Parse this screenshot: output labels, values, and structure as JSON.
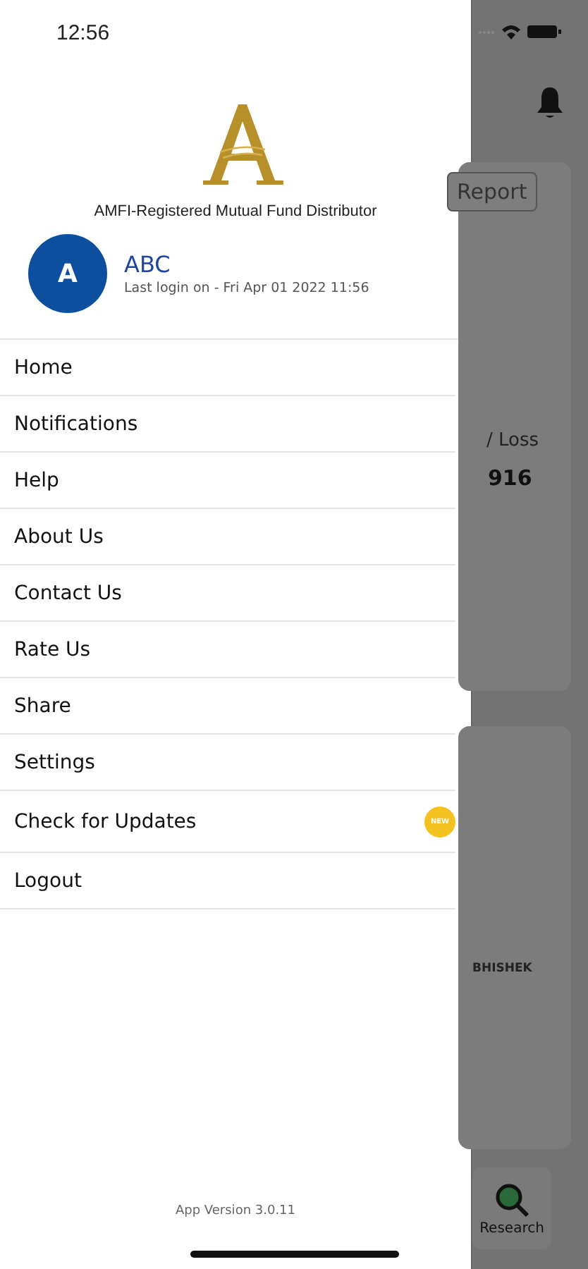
{
  "status_bar": {
    "time": "12:56"
  },
  "drawer": {
    "tagline": "AMFI-Registered Mutual Fund Distributor",
    "user": {
      "initial": "A",
      "name": "ABC",
      "last_login": "Last login on - Fri Apr 01 2022 11:56"
    },
    "menu": [
      {
        "label": "Home"
      },
      {
        "label": "Notifications"
      },
      {
        "label": "Help"
      },
      {
        "label": "About Us"
      },
      {
        "label": "Contact Us"
      },
      {
        "label": "Rate Us"
      },
      {
        "label": "Share"
      },
      {
        "label": "Settings"
      },
      {
        "label": "Check for Updates",
        "badge": "NEW"
      },
      {
        "label": "Logout"
      }
    ],
    "app_version": "App Version 3.0.11"
  },
  "background": {
    "report_button": "Report",
    "pl_label": "/ Loss",
    "pl_value": "916",
    "name": "BHISHEK",
    "research_tab": "Research"
  }
}
